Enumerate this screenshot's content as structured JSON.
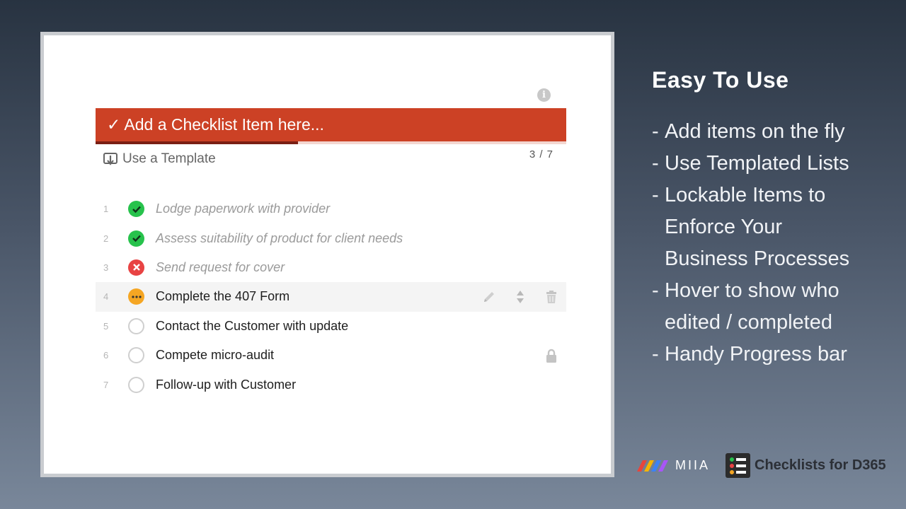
{
  "checklist": {
    "add_placeholder": "✓ Add a Checklist Item here...",
    "template_label": "Use a Template",
    "progress_text": "3 / 7",
    "progress_fraction": 0.43,
    "items": [
      {
        "num": "1",
        "label": "Lodge paperwork with provider",
        "status": "done"
      },
      {
        "num": "2",
        "label": "Assess suitability of product for client needs",
        "status": "done"
      },
      {
        "num": "3",
        "label": "Send request for cover",
        "status": "failed"
      },
      {
        "num": "4",
        "label": "Complete the 407 Form",
        "status": "in-progress"
      },
      {
        "num": "5",
        "label": "Contact the Customer with update",
        "status": "open"
      },
      {
        "num": "6",
        "label": "Compete micro-audit",
        "status": "open"
      },
      {
        "num": "7",
        "label": "Follow-up with Customer",
        "status": "open"
      }
    ]
  },
  "features": {
    "title": "Easy To Use",
    "f1": "Add items on the fly",
    "f2": "Use Templated Lists",
    "f3a": "Lockable Items to",
    "f3b": "Enforce Your",
    "f3c": "Business Processes",
    "f4a": "Hover to show who",
    "f4b": "edited / completed",
    "f5": "Handy Progress bar"
  },
  "branding": {
    "miia_text": "MIIA",
    "checklists_text": "Checklists for D365"
  },
  "colors": {
    "accent": "#cc4125",
    "progress": "#7a1f14",
    "done": "#27c24c",
    "failed": "#e84343",
    "in_progress": "#f5a623"
  }
}
